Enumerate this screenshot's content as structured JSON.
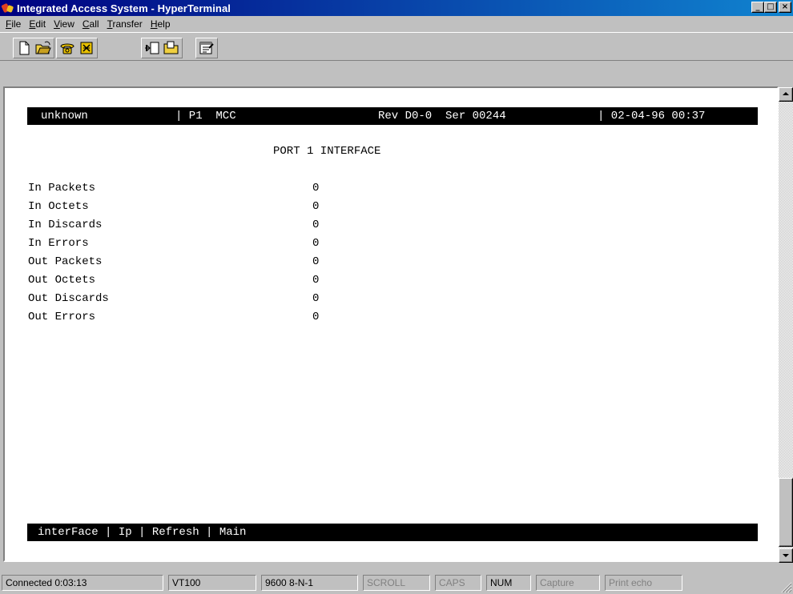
{
  "window": {
    "title": "Integrated Access System - HyperTerminal",
    "controls": [
      "_",
      "□",
      "×"
    ]
  },
  "menu": [
    {
      "label": "File",
      "key": "F",
      "rest": "ile"
    },
    {
      "label": "Edit",
      "key": "E",
      "rest": "dit"
    },
    {
      "label": "View",
      "key": "V",
      "rest": "iew"
    },
    {
      "label": "Call",
      "key": "C",
      "rest": "all"
    },
    {
      "label": "Transfer",
      "key": "T",
      "rest": "ransfer"
    },
    {
      "label": "Help",
      "key": "H",
      "rest": "elp"
    }
  ],
  "toolbar": {
    "buttons": [
      "new-icon",
      "open-icon",
      "connect-icon",
      "disconnect-icon",
      "send-icon",
      "receive-icon",
      "properties-icon"
    ]
  },
  "terminal": {
    "header": {
      "device": "unknown",
      "port": "| P1  MCC",
      "rev": "Rev D0-0  Ser 00244",
      "datetime": "| 02-04-96 00:37"
    },
    "screen_title": "PORT 1 INTERFACE",
    "stats": [
      {
        "label": "In Packets",
        "value": "0"
      },
      {
        "label": "In Octets",
        "value": "0"
      },
      {
        "label": "In Discards",
        "value": "0"
      },
      {
        "label": "In Errors",
        "value": "0"
      },
      {
        "label": "Out Packets",
        "value": "0"
      },
      {
        "label": "Out Octets",
        "value": "0"
      },
      {
        "label": "Out Discards",
        "value": "0"
      },
      {
        "label": "Out Errors",
        "value": "0"
      }
    ],
    "footer": "interFace | Ip | Refresh | Main"
  },
  "status": {
    "connected": "Connected 0:03:13",
    "emulation": "VT100",
    "settings": "9600 8-N-1",
    "scroll": "SCROLL",
    "caps": "CAPS",
    "num": "NUM",
    "capture": "Capture",
    "print_echo": "Print echo"
  },
  "colors": {
    "title_start": "#000080",
    "title_end": "#1084d0",
    "terminal_bg": "#ffffff",
    "terminal_bar": "#000000"
  }
}
